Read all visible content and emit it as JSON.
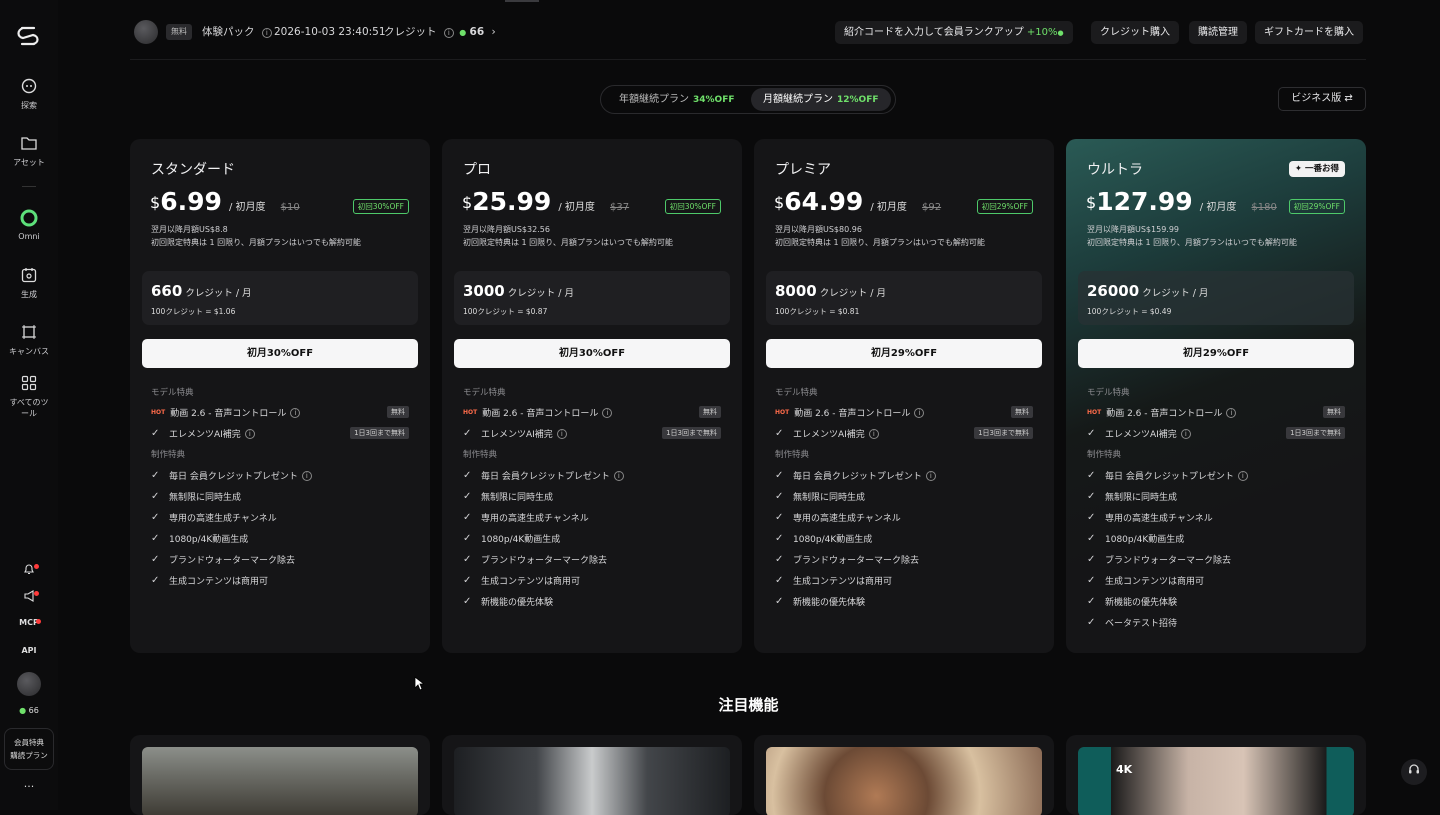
{
  "sidebar": {
    "items": [
      {
        "label": "探索",
        "icon": "explore-icon"
      },
      {
        "label": "アセット",
        "icon": "folder-icon"
      },
      {
        "label": "Omni",
        "icon": "omni-icon"
      },
      {
        "label": "生成",
        "icon": "generate-icon"
      },
      {
        "label": "キャンバス",
        "icon": "canvas-icon"
      },
      {
        "label": "すべてのツール",
        "icon": "grid-icon"
      }
    ],
    "mcp": "MCP",
    "api": "API",
    "credits": "66",
    "member_line1": "会員特典",
    "member_line2": "購読プラン",
    "more": "···"
  },
  "topbar": {
    "free_tag": "無料",
    "pack": "体験パック",
    "datetime": "2026-10-03 23:40:51",
    "credit_label": "クレジット",
    "credit_value": "66",
    "referral": "紹介コードを入力して会員ランクアップ",
    "referral_bonus": "+10%",
    "buy_credits": "クレジット購入",
    "subscription": "購読管理",
    "gift_card": "ギフトカードを購入"
  },
  "billing": {
    "yearly": "年額継続プラン",
    "yearly_off": "34%OFF",
    "monthly": "月額継続プラン",
    "monthly_off": "12%OFF",
    "selected": "monthly",
    "business": "ビジネス版"
  },
  "labels": {
    "model_benefits": "モデル特典",
    "production_benefits": "制作特典",
    "hot": "HOT"
  },
  "plans": [
    {
      "name": "スタンダード",
      "currency": "$",
      "price": "6.99",
      "per": "/ 初月度",
      "old": "$10",
      "badge": "初回30%OFF",
      "after": "翌月以降月額US$8.8",
      "note": "初回限定特典は 1 回限り、月額プランはいつでも解約可能",
      "credits": "660",
      "credit_unit": "クレジット / 月",
      "rate": "100クレジット = $1.06",
      "cta": "初月30%OFF",
      "model": [
        {
          "text": "動画 2.6 - 音声コントロール",
          "pill": "無料"
        },
        {
          "text": "エレメンツAI補完",
          "pill": "1日3回まで無料"
        }
      ],
      "features": [
        "毎日 会員クレジットプレゼント",
        "無制限に同時生成",
        "専用の高速生成チャンネル",
        "1080p/4K動画生成",
        "ブランドウォーターマーク除去",
        "生成コンテンツは商用可"
      ]
    },
    {
      "name": "プロ",
      "currency": "$",
      "price": "25.99",
      "per": "/ 初月度",
      "old": "$37",
      "badge": "初回30%OFF",
      "after": "翌月以降月額US$32.56",
      "note": "初回限定特典は 1 回限り、月額プランはいつでも解約可能",
      "credits": "3000",
      "credit_unit": "クレジット / 月",
      "rate": "100クレジット = $0.87",
      "cta": "初月30%OFF",
      "model": [
        {
          "text": "動画 2.6 - 音声コントロール",
          "pill": "無料"
        },
        {
          "text": "エレメンツAI補完",
          "pill": "1日3回まで無料"
        }
      ],
      "features": [
        "毎日 会員クレジットプレゼント",
        "無制限に同時生成",
        "専用の高速生成チャンネル",
        "1080p/4K動画生成",
        "ブランドウォーターマーク除去",
        "生成コンテンツは商用可",
        "新機能の優先体験"
      ]
    },
    {
      "name": "プレミア",
      "currency": "$",
      "price": "64.99",
      "per": "/ 初月度",
      "old": "$92",
      "badge": "初回29%OFF",
      "after": "翌月以降月額US$80.96",
      "note": "初回限定特典は 1 回限り、月額プランはいつでも解約可能",
      "credits": "8000",
      "credit_unit": "クレジット / 月",
      "rate": "100クレジット = $0.81",
      "cta": "初月29%OFF",
      "model": [
        {
          "text": "動画 2.6 - 音声コントロール",
          "pill": "無料"
        },
        {
          "text": "エレメンツAI補完",
          "pill": "1日3回まで無料"
        }
      ],
      "features": [
        "毎日 会員クレジットプレゼント",
        "無制限に同時生成",
        "専用の高速生成チャンネル",
        "1080p/4K動画生成",
        "ブランドウォーターマーク除去",
        "生成コンテンツは商用可",
        "新機能の優先体験"
      ]
    },
    {
      "name": "ウルトラ",
      "currency": "$",
      "price": "127.99",
      "per": "/ 初月度",
      "old": "$180",
      "badge": "初回29%OFF",
      "best": "✦ 一番お得",
      "after": "翌月以降月額US$159.99",
      "note": "初回限定特典は 1 回限り、月額プランはいつでも解約可能",
      "credits": "26000",
      "credit_unit": "クレジット / 月",
      "rate": "100クレジット = $0.49",
      "cta": "初月29%OFF",
      "model": [
        {
          "text": "動画 2.6 - 音声コントロール",
          "pill": "無料"
        },
        {
          "text": "エレメンツAI補完",
          "pill": "1日3回まで無料"
        }
      ],
      "features": [
        "毎日 会員クレジットプレゼント",
        "無制限に同時生成",
        "専用の高速生成チャンネル",
        "1080p/4K動画生成",
        "ブランドウォーターマーク除去",
        "生成コンテンツは商用可",
        "新機能の優先体験",
        "ベータテスト招待"
      ]
    }
  ],
  "featured": {
    "title": "注目機能",
    "badge_4k": "4K"
  },
  "colors": {
    "accent_green": "#6fe06a",
    "ultra_teal": "#2a5a55",
    "background": "#0a0a0b"
  }
}
